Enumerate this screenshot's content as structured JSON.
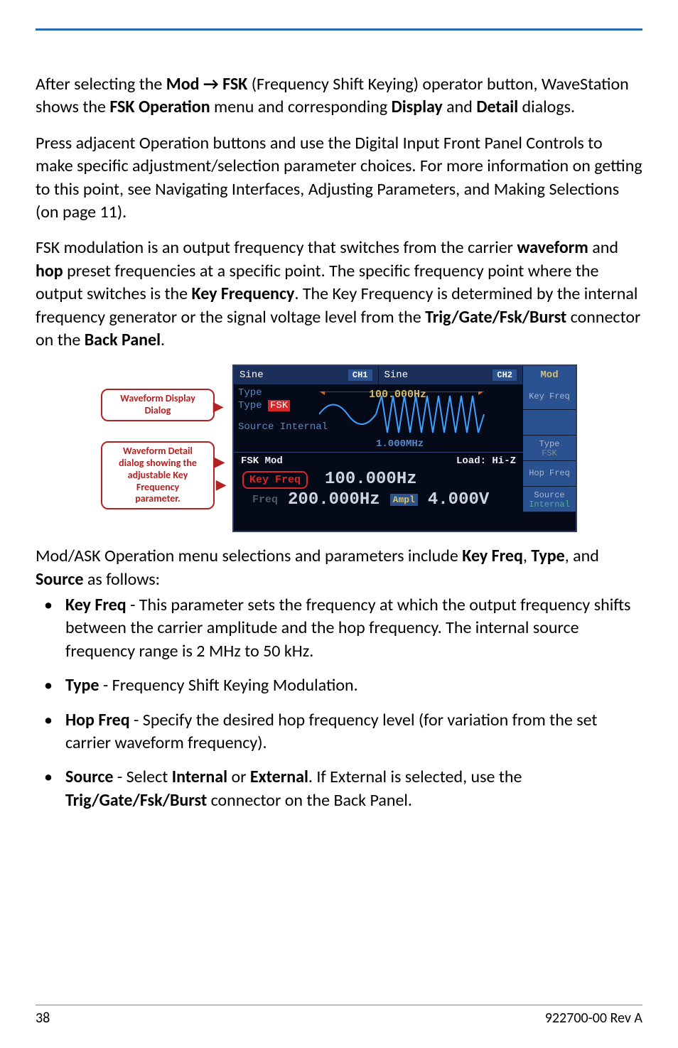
{
  "para1_pre": "After selecting the ",
  "para1_b1": "Mod → FSK",
  "para1_mid1": " (Frequency Shift Keying) operator button, WaveStation shows the ",
  "para1_b2": "FSK Operation",
  "para1_mid2": " menu and corresponding ",
  "para1_b3": "Display",
  "para1_mid3": " and ",
  "para1_b4": "Detail",
  "para1_end": " dialogs.",
  "para2": "Press adjacent Operation buttons and use the Digital Input Front Panel Controls to make specific adjustment/selection parameter choices. For more information on getting to this point, see Navigating Interfaces, Adjusting Parameters, and Making Selections (on page 11).",
  "para3_pre": "FSK modulation is an output frequency that switches from the carrier ",
  "para3_b1": "waveform",
  "para3_mid1": " and ",
  "para3_b2": "hop",
  "para3_mid2": " preset frequencies at a specific point. The specific frequency point where the output switches is the ",
  "para3_b3": "Key Frequency",
  "para3_mid3": ". The Key Frequency is determined by the internal frequency generator or the signal voltage level from the ",
  "para3_b4": "Trig/Gate/Fsk/Burst",
  "para3_mid4": " connector on the ",
  "para3_b5": "Back Panel",
  "para3_end": ".",
  "callout1_l1": "Waveform Display",
  "callout1_l2": "Dialog",
  "callout2_l1": "Waveform Detail",
  "callout2_l2": "dialog showing the",
  "callout2_l3": "adjustable Key",
  "callout2_l4": "Frequency",
  "callout2_l5": "parameter.",
  "device": {
    "ch1_wave": "Sine",
    "ch1_label": "CH1",
    "ch2_wave": "Sine",
    "ch2_label": "CH2",
    "mod_label": "Mod",
    "side": {
      "keyfreq": "Key Freq",
      "type_label": "Type",
      "type_value": "FSK",
      "hopfreq": "Hop Freq",
      "source_label": "Source",
      "source_value": "Internal"
    },
    "display": {
      "type_label": "Type",
      "type_hl": "FSK",
      "source_line": "Source Internal",
      "freq_marker": "100.000Hz",
      "freq_sub": "1.000MHz"
    },
    "detail": {
      "header_left": "FSK Mod",
      "header_right": "Load: Hi-Z",
      "key_freq_label": "Key Freq",
      "key_freq_value": "100.000Hz",
      "freq_gray": "Freq",
      "freq_value": "200.000Hz",
      "ampl_label": "Ampl",
      "ampl_value": "4.000V"
    }
  },
  "para4_pre": "Mod/ASK Operation menu selections and parameters include ",
  "para4_b1": "Key Freq",
  "para4_mid1": ", ",
  "para4_b2": "Type",
  "para4_mid2": ", and ",
  "para4_b3": "Source",
  "para4_end": " as follows:",
  "bul1_b": "Key Freq",
  "bul1_t": " - This parameter sets the frequency at which the output frequency shifts between the carrier amplitude and the hop frequency. The internal source frequency range is 2 MHz to 50 kHz.",
  "bul2_b": "Type",
  "bul2_t": " - Frequency Shift Keying Modulation.",
  "bul3_b": "Hop Freq",
  "bul3_t": " - Specify the desired hop frequency level (for variation from the set carrier waveform frequency).",
  "bul4_b1": "Source",
  "bul4_t1": " - Select ",
  "bul4_b2": "Internal",
  "bul4_t2": " or ",
  "bul4_b3": "External",
  "bul4_t3": ". If External is selected, use the ",
  "bul4_b4": "Trig/Gate/Fsk/Burst",
  "bul4_t4": " connector on the Back Panel.",
  "page_number": "38",
  "doc_id": "922700-00 Rev A"
}
